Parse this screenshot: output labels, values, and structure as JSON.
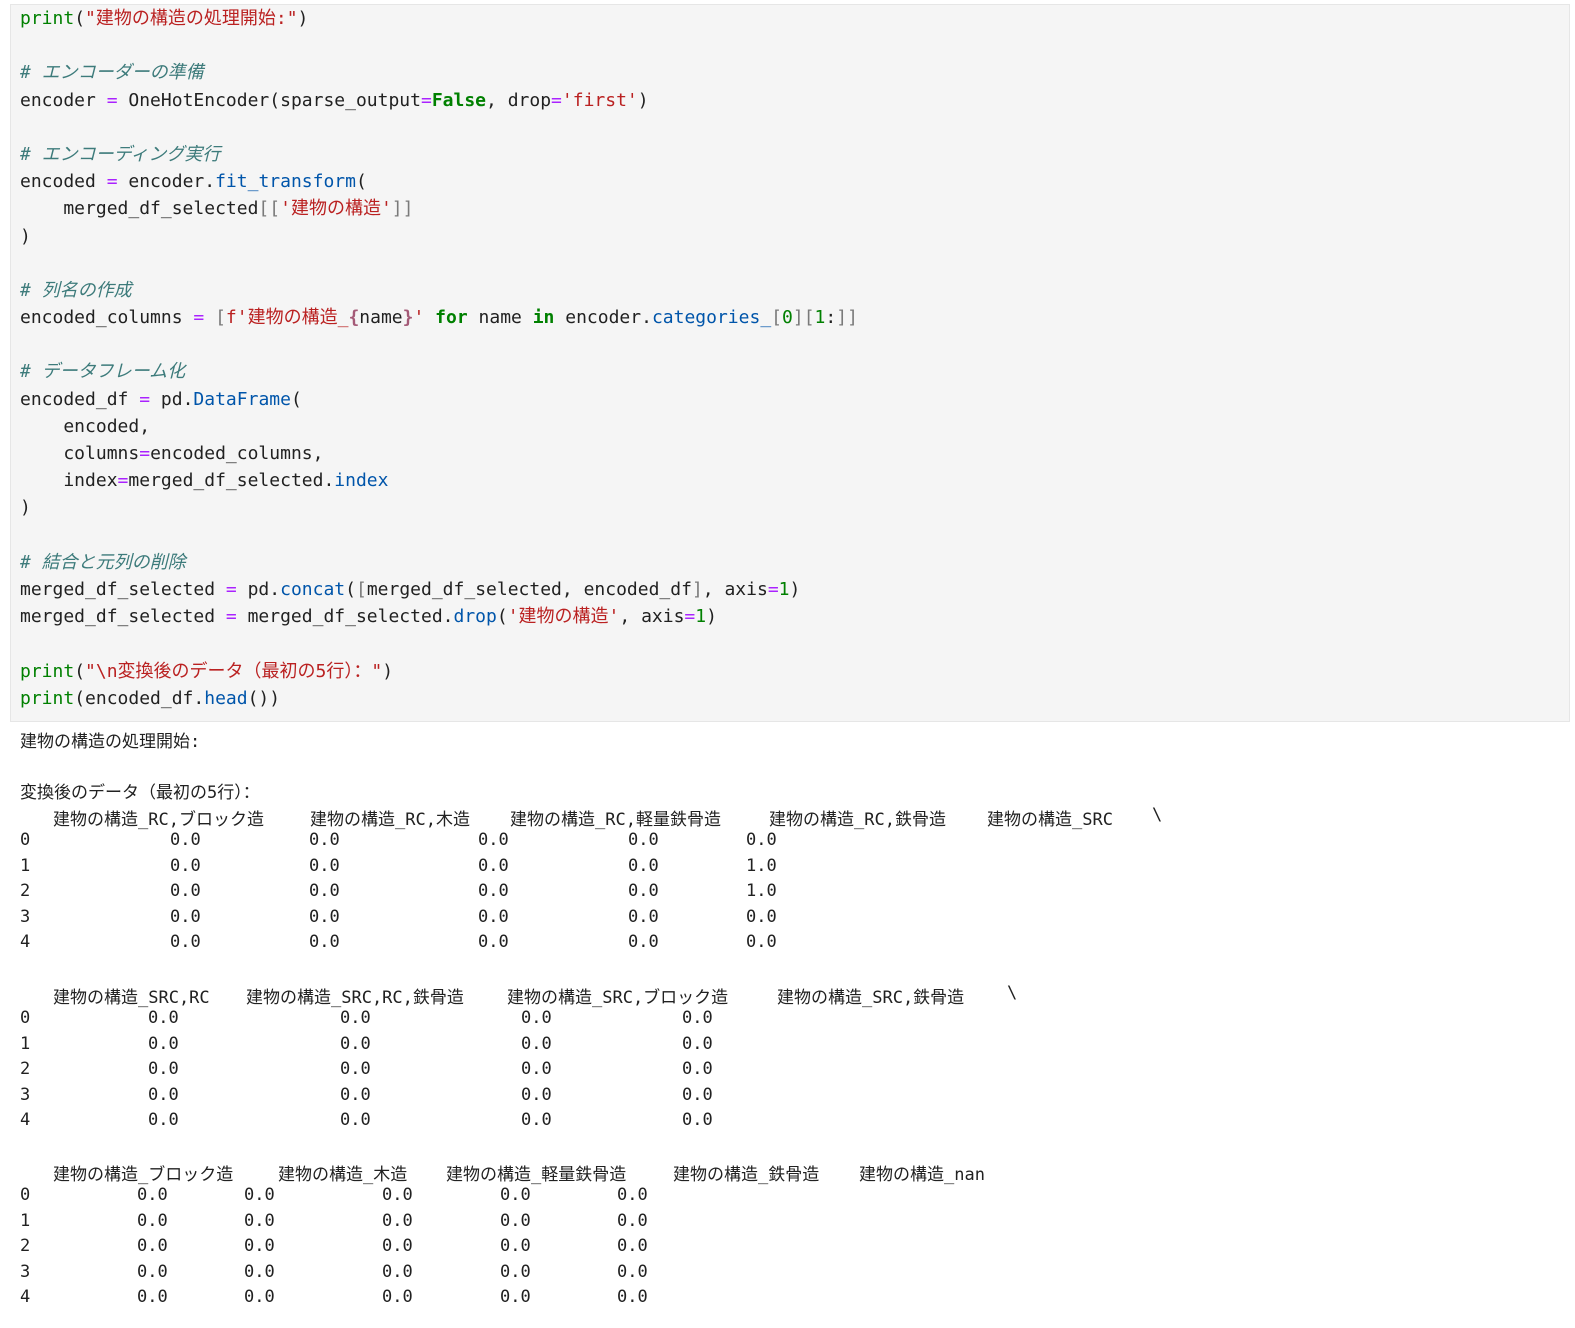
{
  "code_lines": [
    [
      {
        "t": "print",
        "c": "k"
      },
      {
        "t": "(",
        "c": "n"
      },
      {
        "t": "\"建物の構造の処理開始:\"",
        "c": "s"
      },
      {
        "t": ")",
        "c": "n"
      }
    ],
    [],
    [
      {
        "t": "# エンコーダーの準備",
        "c": "cm"
      }
    ],
    [
      {
        "t": "encoder ",
        "c": "n"
      },
      {
        "t": "=",
        "c": "o"
      },
      {
        "t": " OneHotEncoder(sparse_output",
        "c": "n"
      },
      {
        "t": "=",
        "c": "o"
      },
      {
        "t": "False",
        "c": "kb"
      },
      {
        "t": ", drop",
        "c": "n"
      },
      {
        "t": "=",
        "c": "o"
      },
      {
        "t": "'first'",
        "c": "s"
      },
      {
        "t": ")",
        "c": "n"
      }
    ],
    [],
    [
      {
        "t": "# エンコーディング実行",
        "c": "cm"
      }
    ],
    [
      {
        "t": "encoded ",
        "c": "n"
      },
      {
        "t": "=",
        "c": "o"
      },
      {
        "t": " encoder.",
        "c": "n"
      },
      {
        "t": "fit_transform",
        "c": "a"
      },
      {
        "t": "(",
        "c": "n"
      }
    ],
    [
      {
        "t": "    merged_df_selected",
        "c": "n"
      },
      {
        "t": "[[",
        "c": "br"
      },
      {
        "t": "'建物の構造'",
        "c": "s"
      },
      {
        "t": "]]",
        "c": "br"
      }
    ],
    [
      {
        "t": ")",
        "c": "n"
      }
    ],
    [],
    [
      {
        "t": "# 列名の作成",
        "c": "cm"
      }
    ],
    [
      {
        "t": "encoded_columns ",
        "c": "n"
      },
      {
        "t": "=",
        "c": "o"
      },
      {
        "t": " ",
        "c": "n"
      },
      {
        "t": "[",
        "c": "br"
      },
      {
        "t": "f'建物の構造_",
        "c": "s"
      },
      {
        "t": "{",
        "c": "s-in"
      },
      {
        "t": "name",
        "c": "n"
      },
      {
        "t": "}",
        "c": "s-in"
      },
      {
        "t": "'",
        "c": "s"
      },
      {
        "t": " ",
        "c": "n"
      },
      {
        "t": "for",
        "c": "kb"
      },
      {
        "t": " name ",
        "c": "n"
      },
      {
        "t": "in",
        "c": "kb"
      },
      {
        "t": " encoder.",
        "c": "n"
      },
      {
        "t": "categories_",
        "c": "a"
      },
      {
        "t": "[",
        "c": "br"
      },
      {
        "t": "0",
        "c": "num"
      },
      {
        "t": "][",
        "c": "br"
      },
      {
        "t": "1",
        "c": "num"
      },
      {
        "t": ":",
        "c": "n"
      },
      {
        "t": "]]",
        "c": "br"
      }
    ],
    [],
    [
      {
        "t": "# データフレーム化",
        "c": "cm"
      }
    ],
    [
      {
        "t": "encoded_df ",
        "c": "n"
      },
      {
        "t": "=",
        "c": "o"
      },
      {
        "t": " pd.",
        "c": "n"
      },
      {
        "t": "DataFrame",
        "c": "a"
      },
      {
        "t": "(",
        "c": "n"
      }
    ],
    [
      {
        "t": "    encoded,",
        "c": "n"
      }
    ],
    [
      {
        "t": "    columns",
        "c": "n"
      },
      {
        "t": "=",
        "c": "o"
      },
      {
        "t": "encoded_columns,",
        "c": "n"
      }
    ],
    [
      {
        "t": "    index",
        "c": "n"
      },
      {
        "t": "=",
        "c": "o"
      },
      {
        "t": "merged_df_selected.",
        "c": "n"
      },
      {
        "t": "index",
        "c": "a"
      }
    ],
    [
      {
        "t": ")",
        "c": "n"
      }
    ],
    [],
    [
      {
        "t": "# 結合と元列の削除",
        "c": "cm"
      }
    ],
    [
      {
        "t": "merged_df_selected ",
        "c": "n"
      },
      {
        "t": "=",
        "c": "o"
      },
      {
        "t": " pd.",
        "c": "n"
      },
      {
        "t": "concat",
        "c": "a"
      },
      {
        "t": "(",
        "c": "n"
      },
      {
        "t": "[",
        "c": "br"
      },
      {
        "t": "merged_df_selected, encoded_df",
        "c": "n"
      },
      {
        "t": "]",
        "c": "br"
      },
      {
        "t": ", axis",
        "c": "n"
      },
      {
        "t": "=",
        "c": "o"
      },
      {
        "t": "1",
        "c": "num"
      },
      {
        "t": ")",
        "c": "n"
      }
    ],
    [
      {
        "t": "merged_df_selected ",
        "c": "n"
      },
      {
        "t": "=",
        "c": "o"
      },
      {
        "t": " merged_df_selected.",
        "c": "n"
      },
      {
        "t": "drop",
        "c": "a"
      },
      {
        "t": "(",
        "c": "n"
      },
      {
        "t": "'建物の構造'",
        "c": "s"
      },
      {
        "t": ", axis",
        "c": "n"
      },
      {
        "t": "=",
        "c": "o"
      },
      {
        "t": "1",
        "c": "num"
      },
      {
        "t": ")",
        "c": "n"
      }
    ],
    [],
    [
      {
        "t": "print",
        "c": "k"
      },
      {
        "t": "(",
        "c": "n"
      },
      {
        "t": "\"\\n変換後のデータ（最初の5行）：\"",
        "c": "s"
      },
      {
        "t": ")",
        "c": "n"
      }
    ],
    [
      {
        "t": "print",
        "c": "k"
      },
      {
        "t": "(encoded_df.",
        "c": "n"
      },
      {
        "t": "head",
        "c": "a"
      },
      {
        "t": "())",
        "c": "n"
      }
    ]
  ],
  "output": {
    "line1": "建物の構造の処理開始:",
    "line2": "変換後のデータ（最初の5行）：",
    "tables": [
      {
        "headers": [
          "建物の構造_RC,ブロック造",
          "建物の構造_RC,木造",
          "建物の構造_RC,軽量鉄骨造",
          "建物の構造_RC,鉄骨造",
          "建物の構造_SRC",
          "\\"
        ],
        "index": [
          "0",
          "1",
          "2",
          "3",
          "4"
        ],
        "rows": [
          [
            "0.0",
            "0.0",
            "0.0",
            "0.0",
            "0.0"
          ],
          [
            "0.0",
            "0.0",
            "0.0",
            "0.0",
            "1.0"
          ],
          [
            "0.0",
            "0.0",
            "0.0",
            "0.0",
            "1.0"
          ],
          [
            "0.0",
            "0.0",
            "0.0",
            "0.0",
            "0.0"
          ],
          [
            "0.0",
            "0.0",
            "0.0",
            "0.0",
            "0.0"
          ]
        ]
      },
      {
        "headers": [
          "建物の構造_SRC,RC",
          "建物の構造_SRC,RC,鉄骨造",
          "建物の構造_SRC,ブロック造",
          "建物の構造_SRC,鉄骨造",
          "\\"
        ],
        "index": [
          "0",
          "1",
          "2",
          "3",
          "4"
        ],
        "rows": [
          [
            "0.0",
            "0.0",
            "0.0",
            "0.0"
          ],
          [
            "0.0",
            "0.0",
            "0.0",
            "0.0"
          ],
          [
            "0.0",
            "0.0",
            "0.0",
            "0.0"
          ],
          [
            "0.0",
            "0.0",
            "0.0",
            "0.0"
          ],
          [
            "0.0",
            "0.0",
            "0.0",
            "0.0"
          ]
        ]
      },
      {
        "headers": [
          "建物の構造_ブロック造",
          "建物の構造_木造",
          "建物の構造_軽量鉄骨造",
          "建物の構造_鉄骨造",
          "建物の構造_nan"
        ],
        "index": [
          "0",
          "1",
          "2",
          "3",
          "4"
        ],
        "rows": [
          [
            "0.0",
            "0.0",
            "0.0",
            "0.0",
            "0.0"
          ],
          [
            "0.0",
            "0.0",
            "0.0",
            "0.0",
            "0.0"
          ],
          [
            "0.0",
            "0.0",
            "0.0",
            "0.0",
            "0.0"
          ],
          [
            "0.0",
            "0.0",
            "0.0",
            "0.0",
            "0.0"
          ],
          [
            "0.0",
            "0.0",
            "0.0",
            "0.0",
            "0.0"
          ]
        ]
      }
    ]
  }
}
